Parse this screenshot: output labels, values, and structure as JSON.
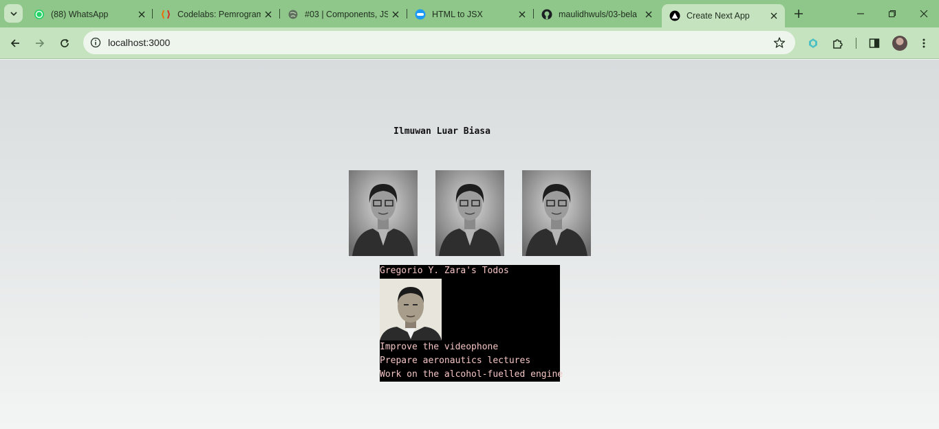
{
  "browser": {
    "tabs": [
      {
        "title": "(88) WhatsApp",
        "icon": "whatsapp-icon",
        "active": false
      },
      {
        "title": "Codelabs: Pemrogram",
        "icon": "codelabs-icon",
        "active": false
      },
      {
        "title": "#03 | Components, JS",
        "icon": "globe-icon",
        "active": false
      },
      {
        "title": "HTML to JSX",
        "icon": "html-to-jsx-icon",
        "active": false
      },
      {
        "title": "maulidhwuls/03-bela",
        "icon": "github-icon",
        "active": false
      },
      {
        "title": "Create Next App",
        "icon": "nextjs-icon",
        "active": true
      }
    ],
    "url": "localhost:3000"
  },
  "page": {
    "heading": "Ilmuwan Luar Biasa",
    "scientist_images": [
      "portrait",
      "portrait",
      "portrait"
    ],
    "todos": {
      "title": "Gregorio Y. Zara's Todos",
      "items": [
        "Improve the videophone",
        "Prepare aeronautics lectures",
        "Work on the alcohol-fuelled engine"
      ]
    }
  },
  "colors": {
    "tabstrip": "#8fc78a",
    "toolbar": "#c6e3bf",
    "card_background": "#000000",
    "card_text": "#f5c4c4"
  }
}
